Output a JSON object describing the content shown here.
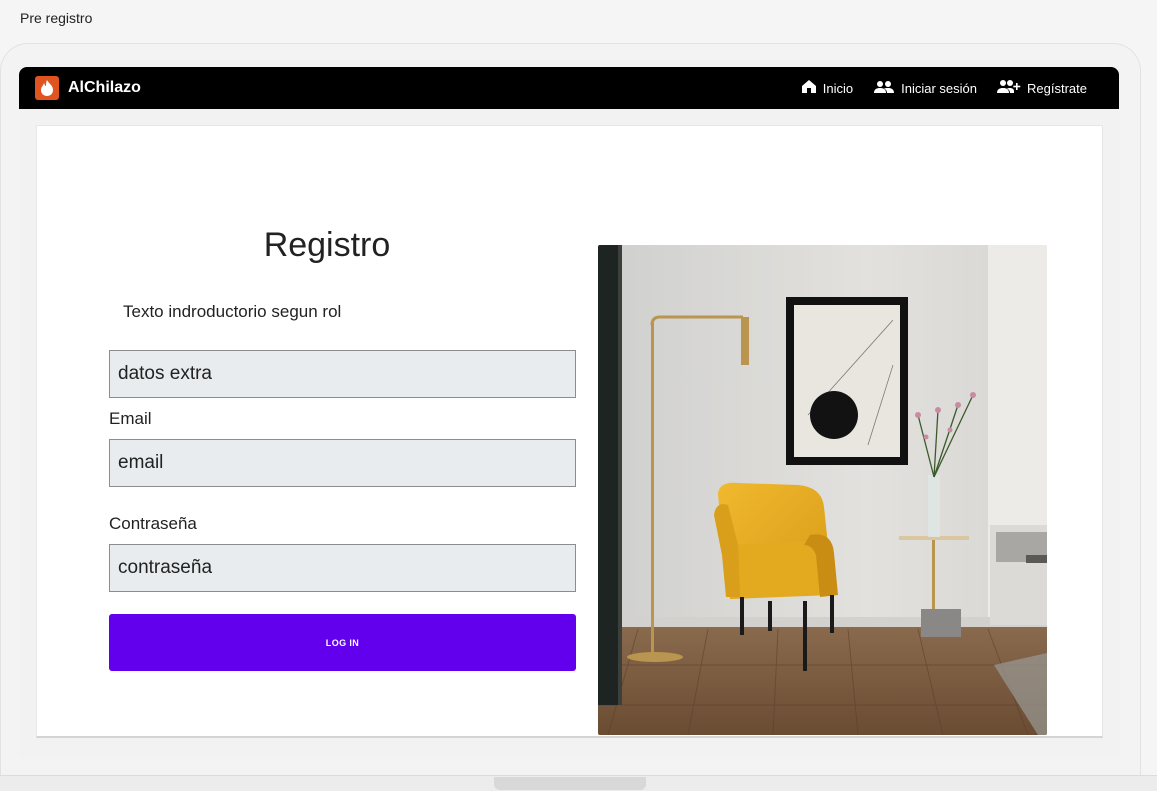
{
  "frame": {
    "title": "Pre registro"
  },
  "navbar": {
    "brand": "AlChilazo",
    "links": [
      {
        "label": "Inicio",
        "icon": "home-icon"
      },
      {
        "label": "Iniciar sesión",
        "icon": "users-icon"
      },
      {
        "label": "Regístrate",
        "icon": "add-user-icon"
      }
    ]
  },
  "form": {
    "title": "Registro",
    "intro": "Texto indroductorio segun rol",
    "extra_field_value": "datos extra",
    "email_label": "Email",
    "email_value": "email",
    "password_label": "Contraseña",
    "password_value": "contraseña",
    "submit_label": "LOG IN"
  },
  "colors": {
    "navbar_bg": "#000000",
    "brand_accent": "#e0541f",
    "button_primary": "#6200ee",
    "input_bg": "#e8ecef"
  },
  "image": {
    "subject": "living room with yellow armchair, floor lamp and framed art"
  }
}
